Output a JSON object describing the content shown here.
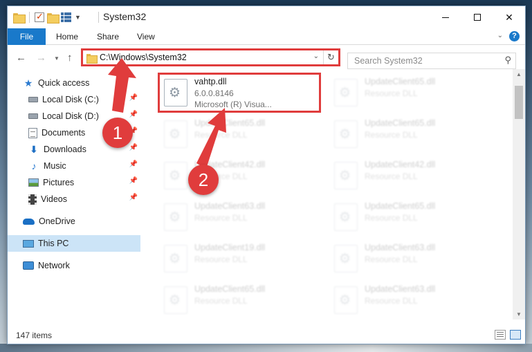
{
  "window": {
    "title": "System32"
  },
  "ribbon": {
    "tabs": [
      "File",
      "Home",
      "Share",
      "View"
    ]
  },
  "address_bar": {
    "path": "C:\\Windows\\System32"
  },
  "search": {
    "placeholder": "Search System32"
  },
  "sidebar": {
    "items": [
      {
        "label": "Quick access",
        "icon": "quick-access-star-icon",
        "pinned": false
      },
      {
        "label": "Local Disk (C:)",
        "icon": "drive-icon",
        "pinned": true
      },
      {
        "label": "Local Disk (D:)",
        "icon": "drive-icon",
        "pinned": true
      },
      {
        "label": "Documents",
        "icon": "documents-icon",
        "pinned": true
      },
      {
        "label": "Downloads",
        "icon": "downloads-icon",
        "pinned": true
      },
      {
        "label": "Music",
        "icon": "music-icon",
        "pinned": true
      },
      {
        "label": "Pictures",
        "icon": "pictures-icon",
        "pinned": true
      },
      {
        "label": "Videos",
        "icon": "videos-icon",
        "pinned": true
      },
      {
        "label": "OneDrive",
        "icon": "onedrive-icon",
        "pinned": false
      },
      {
        "label": "This PC",
        "icon": "this-pc-icon",
        "pinned": false,
        "selected": true
      },
      {
        "label": "Network",
        "icon": "network-icon",
        "pinned": false
      }
    ]
  },
  "files": {
    "highlighted": {
      "name": "vahtp.dll",
      "version": "6.0.0.8146",
      "description": "Microsoft (R) Visua..."
    },
    "grid": [
      [
        {
          "name": "UpdateClient65.dll",
          "description": "Resource DLL"
        },
        {
          "name": "UpdateClient65.dll",
          "description": "Resource DLL"
        }
      ],
      [
        {
          "name": "UpdateClient65.dll",
          "description": "Resource DLL"
        },
        {
          "name": "UpdateClient65.dll",
          "description": "Resource DLL"
        }
      ],
      [
        {
          "name": "UpdateClient42.dll",
          "description": "Resource DLL"
        },
        {
          "name": "UpdateClient42.dll",
          "description": "Resource DLL"
        }
      ],
      [
        {
          "name": "UpdateClient63.dll",
          "description": "Resource DLL"
        },
        {
          "name": "UpdateClient65.dll",
          "description": "Resource DLL"
        }
      ],
      [
        {
          "name": "UpdateClient19.dll",
          "description": "Resource DLL"
        },
        {
          "name": "UpdateClient63.dll",
          "description": "Resource DLL"
        }
      ],
      [
        {
          "name": "UpdateClient65.dll",
          "description": "Resource DLL"
        },
        {
          "name": "UpdateClient63.dll",
          "description": "Resource DLL"
        }
      ]
    ]
  },
  "status": {
    "item_count": "147 items"
  },
  "annotations": {
    "step1": "1",
    "step2": "2",
    "color": "#e03c3c"
  }
}
